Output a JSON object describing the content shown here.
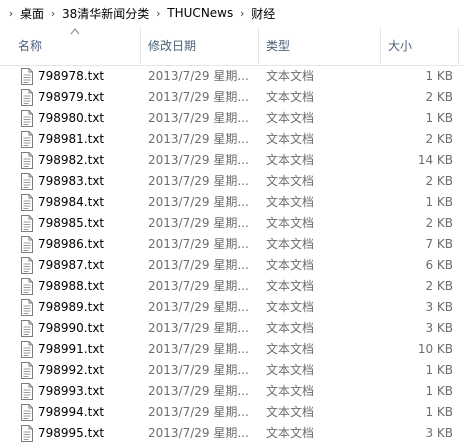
{
  "breadcrumb": [
    "桌面",
    "38清华新闻分类",
    "THUCNews",
    "财经"
  ],
  "columns": {
    "name": "名称",
    "date": "修改日期",
    "type": "类型",
    "size": "大小"
  },
  "icons": {
    "breadcrumb_separator": "chevron-right-icon",
    "sort_indicator": "sort-up-icon",
    "file": "text-file-icon"
  },
  "files": [
    {
      "name": "798978.txt",
      "date": "2013/7/29 星期...",
      "type": "文本文档",
      "size": "1 KB"
    },
    {
      "name": "798979.txt",
      "date": "2013/7/29 星期...",
      "type": "文本文档",
      "size": "2 KB"
    },
    {
      "name": "798980.txt",
      "date": "2013/7/29 星期...",
      "type": "文本文档",
      "size": "1 KB"
    },
    {
      "name": "798981.txt",
      "date": "2013/7/29 星期...",
      "type": "文本文档",
      "size": "2 KB"
    },
    {
      "name": "798982.txt",
      "date": "2013/7/29 星期...",
      "type": "文本文档",
      "size": "14 KB"
    },
    {
      "name": "798983.txt",
      "date": "2013/7/29 星期...",
      "type": "文本文档",
      "size": "2 KB"
    },
    {
      "name": "798984.txt",
      "date": "2013/7/29 星期...",
      "type": "文本文档",
      "size": "1 KB"
    },
    {
      "name": "798985.txt",
      "date": "2013/7/29 星期...",
      "type": "文本文档",
      "size": "2 KB"
    },
    {
      "name": "798986.txt",
      "date": "2013/7/29 星期...",
      "type": "文本文档",
      "size": "7 KB"
    },
    {
      "name": "798987.txt",
      "date": "2013/7/29 星期...",
      "type": "文本文档",
      "size": "6 KB"
    },
    {
      "name": "798988.txt",
      "date": "2013/7/29 星期...",
      "type": "文本文档",
      "size": "2 KB"
    },
    {
      "name": "798989.txt",
      "date": "2013/7/29 星期...",
      "type": "文本文档",
      "size": "3 KB"
    },
    {
      "name": "798990.txt",
      "date": "2013/7/29 星期...",
      "type": "文本文档",
      "size": "3 KB"
    },
    {
      "name": "798991.txt",
      "date": "2013/7/29 星期...",
      "type": "文本文档",
      "size": "10 KB"
    },
    {
      "name": "798992.txt",
      "date": "2013/7/29 星期...",
      "type": "文本文档",
      "size": "1 KB"
    },
    {
      "name": "798993.txt",
      "date": "2013/7/29 星期...",
      "type": "文本文档",
      "size": "1 KB"
    },
    {
      "name": "798994.txt",
      "date": "2013/7/29 星期...",
      "type": "文本文档",
      "size": "1 KB"
    },
    {
      "name": "798995.txt",
      "date": "2013/7/29 星期...",
      "type": "文本文档",
      "size": "3 KB"
    }
  ],
  "colors": {
    "header_text": "#4c607a",
    "secondary_text": "#6d6d6d",
    "divider": "#e5e5e5"
  }
}
